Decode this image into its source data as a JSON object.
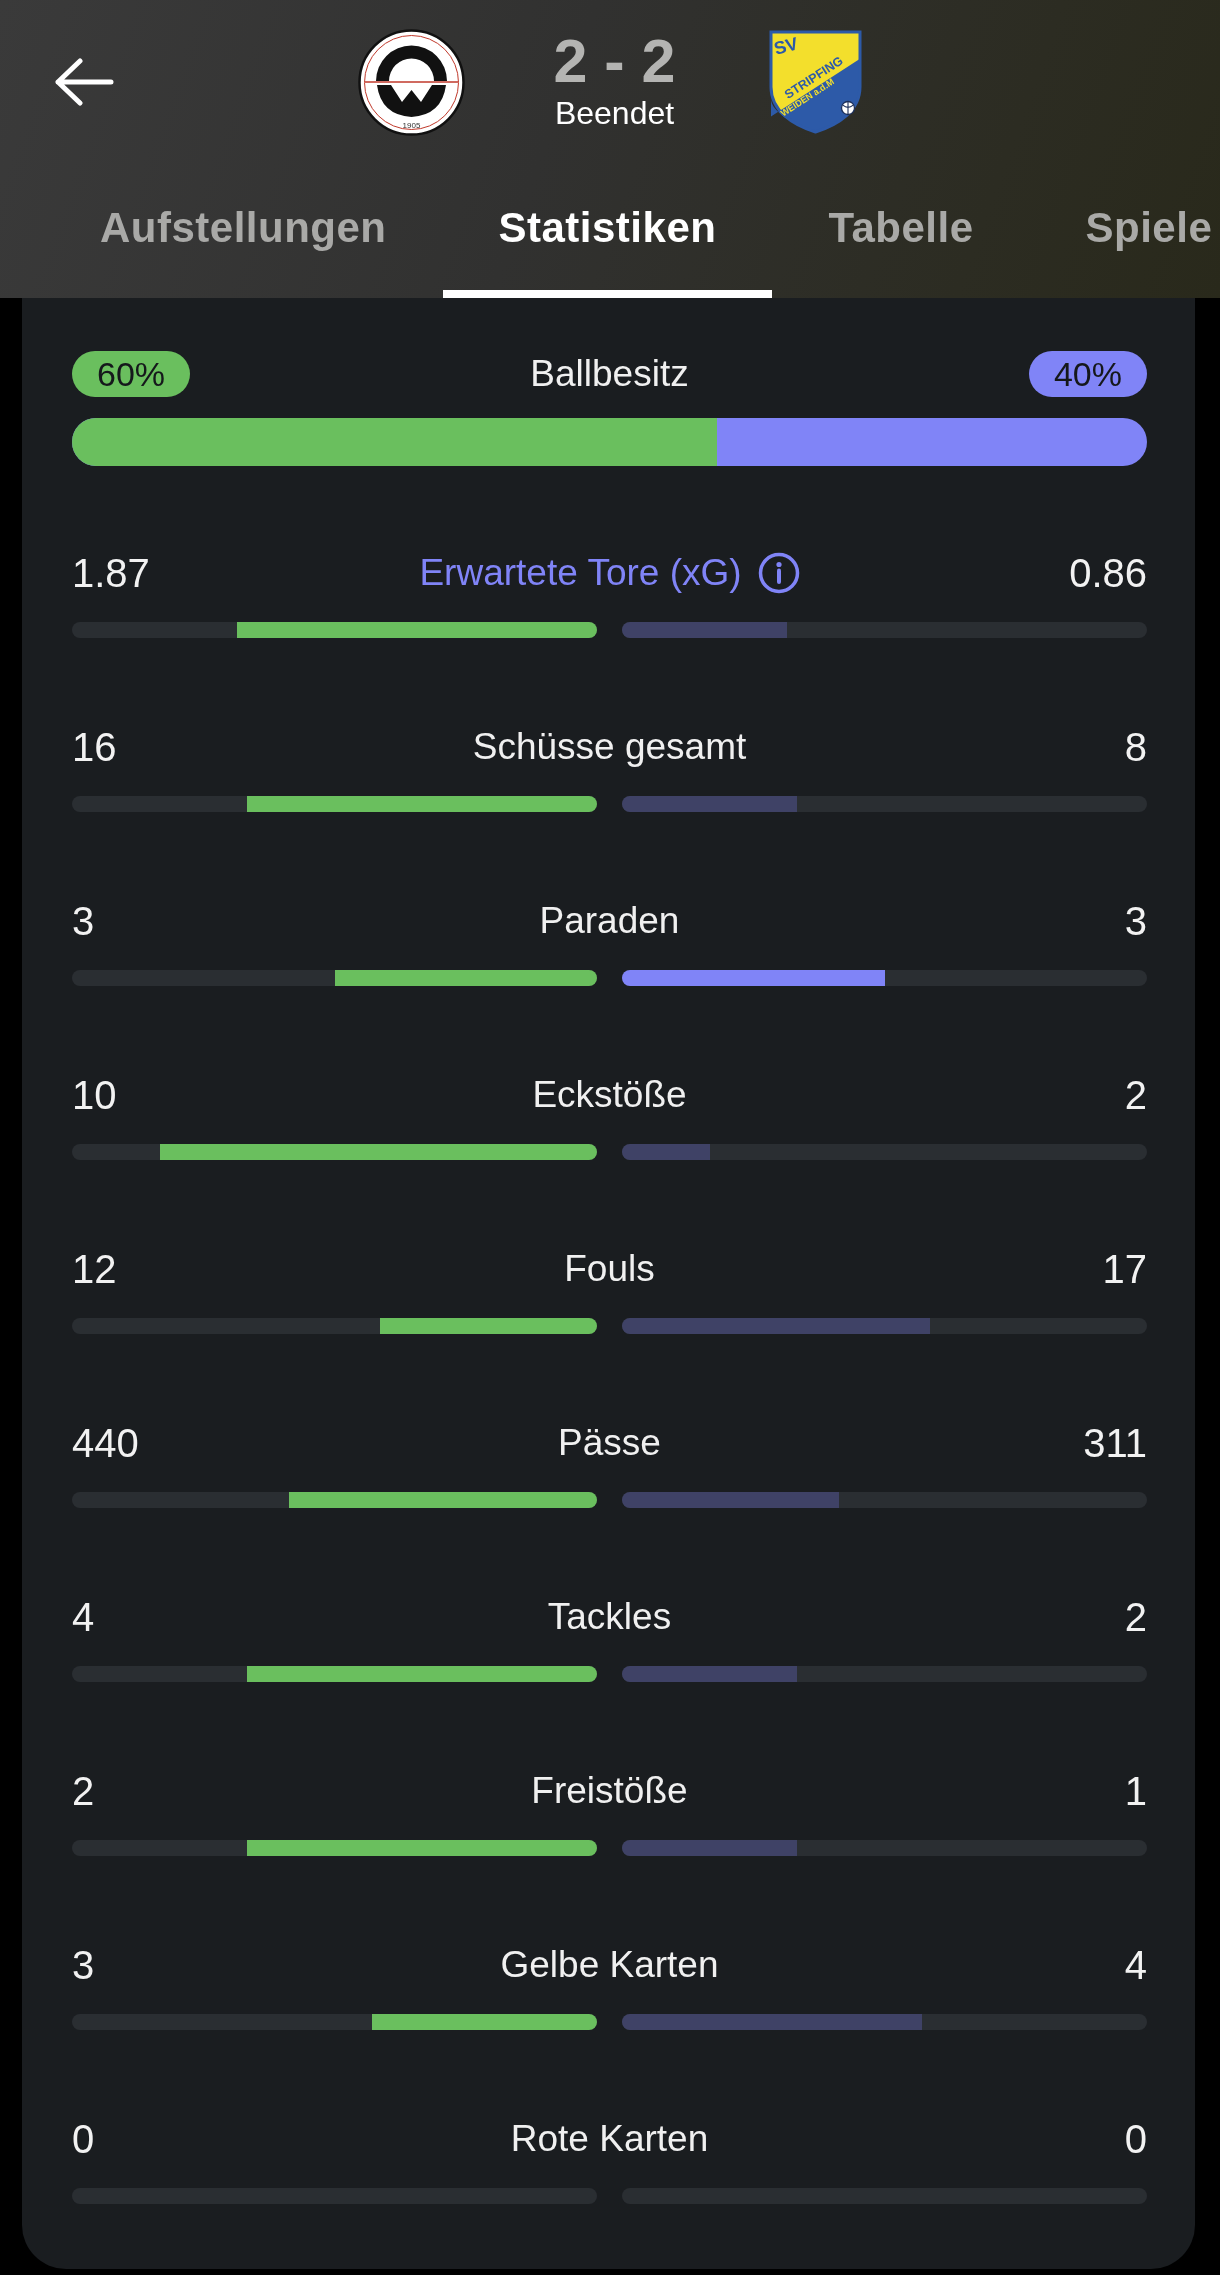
{
  "header": {
    "home_logo": {
      "year": "1905"
    },
    "score": "2 - 2",
    "status": "Beendet",
    "away_logo": {
      "lines": [
        "SV",
        "STRIPFING",
        "WEIDEN a.d.M"
      ]
    }
  },
  "tabs": [
    {
      "label": "Aufstellungen",
      "selected": false
    },
    {
      "label": "Statistiken",
      "selected": true
    },
    {
      "label": "Tabelle",
      "selected": false
    },
    {
      "label": "Spiele",
      "selected": false
    }
  ],
  "stats": [
    {
      "kind": "possession",
      "label": "Ballbesitz",
      "home": {
        "value": "60%"
      },
      "away": {
        "value": "40%"
      },
      "level": 0.6
    },
    {
      "kind": "info",
      "label": "Erwartete Tore (xG)",
      "home": {
        "value": "1.87",
        "level": 0.685,
        "highlighted": true
      },
      "away": {
        "value": "0.86",
        "level": 0.315,
        "highlighted": false
      }
    },
    {
      "kind": "metric",
      "label": "Schüsse gesamt",
      "home": {
        "value": "16",
        "level": 0.667,
        "highlighted": true
      },
      "away": {
        "value": "8",
        "level": 0.333,
        "highlighted": false
      }
    },
    {
      "kind": "metric",
      "label": "Paraden",
      "home": {
        "value": "3",
        "level": 0.5,
        "highlighted": true
      },
      "away": {
        "value": "3",
        "level": 0.5,
        "highlighted": true
      }
    },
    {
      "kind": "metric",
      "label": "Eckstöße",
      "home": {
        "value": "10",
        "level": 0.833,
        "highlighted": true
      },
      "away": {
        "value": "2",
        "level": 0.167,
        "highlighted": false
      }
    },
    {
      "kind": "metric",
      "label": "Fouls",
      "home": {
        "value": "12",
        "level": 0.414,
        "highlighted": true
      },
      "away": {
        "value": "17",
        "level": 0.586,
        "highlighted": false
      }
    },
    {
      "kind": "metric",
      "label": "Pässe",
      "home": {
        "value": "440",
        "level": 0.586,
        "highlighted": true
      },
      "away": {
        "value": "311",
        "level": 0.414,
        "highlighted": false
      }
    },
    {
      "kind": "metric",
      "label": "Tackles",
      "home": {
        "value": "4",
        "level": 0.667,
        "highlighted": true
      },
      "away": {
        "value": "2",
        "level": 0.333,
        "highlighted": false
      }
    },
    {
      "kind": "metric",
      "label": "Freistöße",
      "home": {
        "value": "2",
        "level": 0.667,
        "highlighted": true
      },
      "away": {
        "value": "1",
        "level": 0.333,
        "highlighted": false
      }
    },
    {
      "kind": "metric",
      "label": "Gelbe Karten",
      "home": {
        "value": "3",
        "level": 0.429,
        "highlighted": true
      },
      "away": {
        "value": "4",
        "level": 0.571,
        "highlighted": false
      }
    },
    {
      "kind": "metric",
      "label": "Rote Karten",
      "home": {
        "value": "0",
        "level": 0
      },
      "away": {
        "value": "0",
        "level": 0
      }
    }
  ]
}
